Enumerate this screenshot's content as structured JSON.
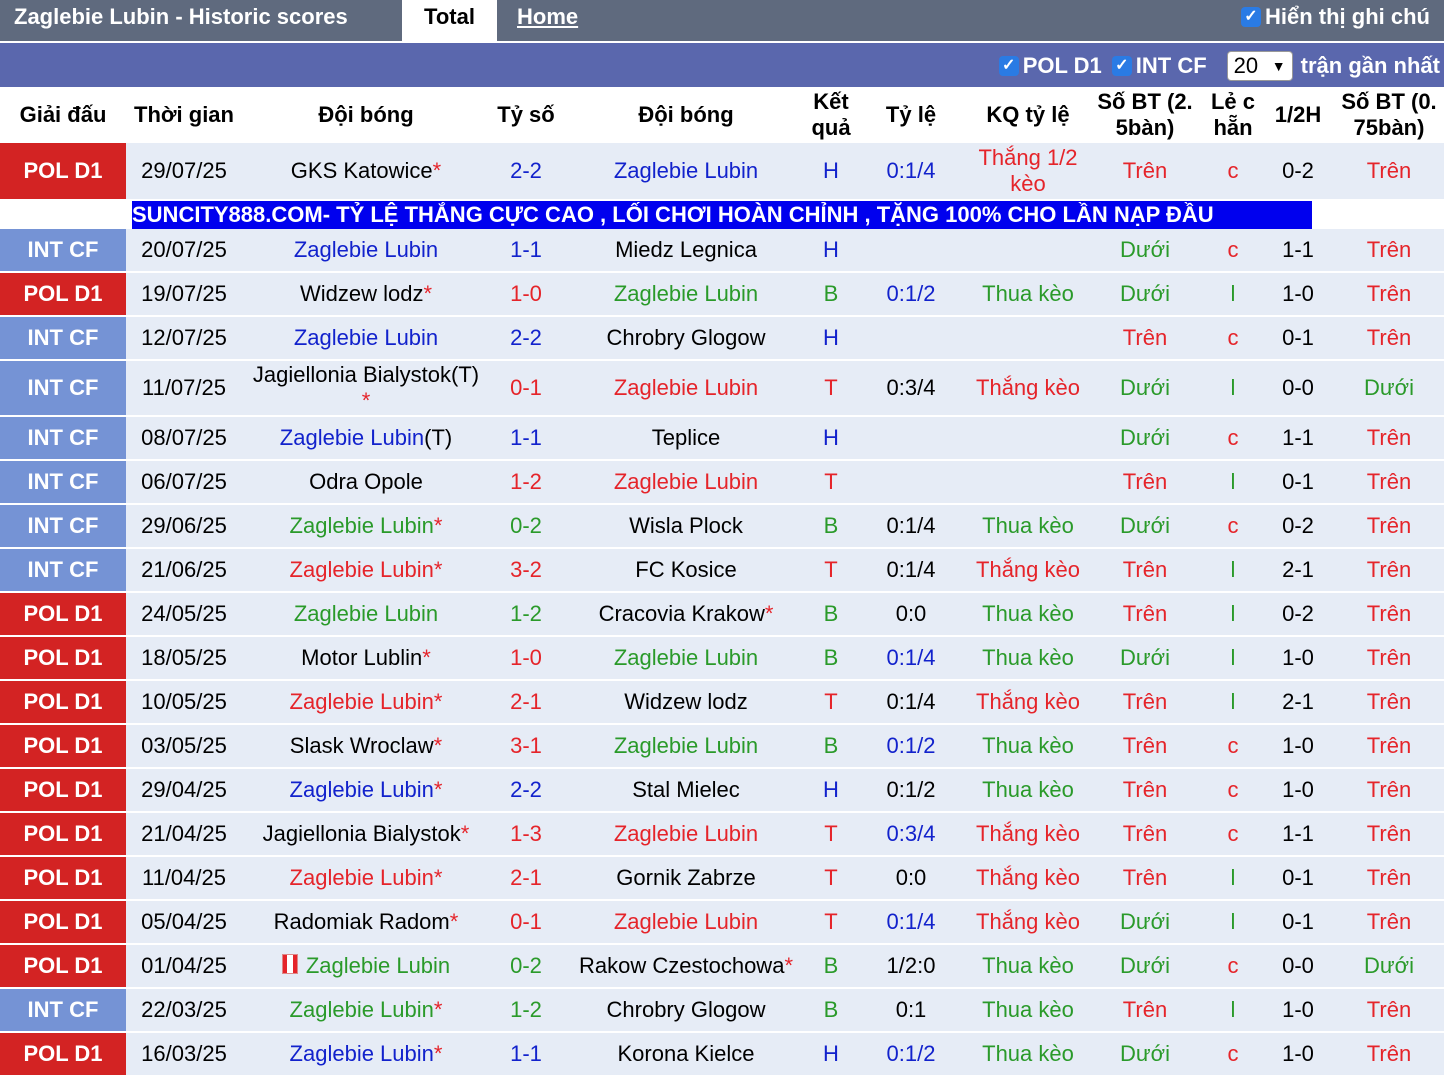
{
  "header": {
    "title": "Zaglebie Lubin - Historic scores",
    "tab_total": "Total",
    "tab_home": "Home",
    "show_notes": "Hiển thị ghi chú"
  },
  "filters": {
    "league1": "POL D1",
    "league2": "INT CF",
    "count": "20",
    "recent_label": "trận gần nhất"
  },
  "columns": [
    "Giải đấu",
    "Thời gian",
    "Đội bóng",
    "Tỷ số",
    "Đội bóng",
    "Kết quả",
    "Tỷ lệ",
    "KQ tỷ lệ",
    "Số BT (2. 5bàn)",
    "Lẻ c hẵn",
    "1/2H",
    "Số BT (0. 75bàn)"
  ],
  "ad_banner": "SUNCITY888.COM- TỶ LỆ THẮNG CỰC CAO , LỐI CHƠI HOÀN CHỈNH , TẶNG 100% CHO LẦN NẠP ĐẦU",
  "colors": {
    "blue": "#1222cc",
    "red": "#e5242a",
    "green": "#2a9a2a",
    "pol_badge": "#d32323",
    "int_badge": "#7593d5",
    "ad_bg": "#0000ee"
  },
  "matches": [
    {
      "league": "POL D1",
      "date": "29/07/25",
      "home": "GKS Katowice",
      "home_star": true,
      "home_color": "black",
      "score": "2-2",
      "score_color": "blue",
      "away": "Zaglebie Lubin",
      "away_star": false,
      "away_color": "blue",
      "result": "H",
      "result_color": "blue",
      "odds": "0:1/4",
      "odds_color": "blue",
      "odds_result": "Thắng 1/2 kèo",
      "odds_result_color": "red",
      "ou25": "Trên",
      "ou25_color": "red",
      "oe": "c",
      "oe_color": "red",
      "half": "0-2",
      "ou075": "Trên",
      "ou075_color": "red"
    },
    {
      "league": "INT CF",
      "date": "20/07/25",
      "home": "Zaglebie Lubin",
      "home_star": false,
      "home_color": "blue",
      "score": "1-1",
      "score_color": "blue",
      "away": "Miedz Legnica",
      "away_star": false,
      "away_color": "black",
      "result": "H",
      "result_color": "blue",
      "odds": "",
      "odds_color": "black",
      "odds_result": "",
      "odds_result_color": "black",
      "ou25": "Dưới",
      "ou25_color": "green",
      "oe": "c",
      "oe_color": "red",
      "half": "1-1",
      "ou075": "Trên",
      "ou075_color": "red"
    },
    {
      "league": "POL D1",
      "date": "19/07/25",
      "home": "Widzew lodz",
      "home_star": true,
      "home_color": "black",
      "score": "1-0",
      "score_color": "red",
      "away": "Zaglebie Lubin",
      "away_star": false,
      "away_color": "green",
      "result": "B",
      "result_color": "green",
      "odds": "0:1/2",
      "odds_color": "blue",
      "odds_result": "Thua kèo",
      "odds_result_color": "green",
      "ou25": "Dưới",
      "ou25_color": "green",
      "oe": "l",
      "oe_color": "green",
      "half": "1-0",
      "ou075": "Trên",
      "ou075_color": "red"
    },
    {
      "league": "INT CF",
      "date": "12/07/25",
      "home": "Zaglebie Lubin",
      "home_star": false,
      "home_color": "blue",
      "score": "2-2",
      "score_color": "blue",
      "away": "Chrobry Glogow",
      "away_star": false,
      "away_color": "black",
      "result": "H",
      "result_color": "blue",
      "odds": "",
      "odds_color": "black",
      "odds_result": "",
      "odds_result_color": "black",
      "ou25": "Trên",
      "ou25_color": "red",
      "oe": "c",
      "oe_color": "red",
      "half": "0-1",
      "ou075": "Trên",
      "ou075_color": "red"
    },
    {
      "league": "INT CF",
      "date": "11/07/25",
      "home": "Jagiellonia Bialystok(T)",
      "home_star": true,
      "home_color": "black",
      "score": "0-1",
      "score_color": "red",
      "away": "Zaglebie Lubin",
      "away_star": false,
      "away_color": "red",
      "result": "T",
      "result_color": "red",
      "odds": "0:3/4",
      "odds_color": "black",
      "odds_result": "Thắng kèo",
      "odds_result_color": "red",
      "ou25": "Dưới",
      "ou25_color": "green",
      "oe": "l",
      "oe_color": "green",
      "half": "0-0",
      "ou075": "Dưới",
      "ou075_color": "green"
    },
    {
      "league": "INT CF",
      "date": "08/07/25",
      "home": "Zaglebie Lubin",
      "home_suffix": "(T)",
      "home_star": false,
      "home_color": "blue",
      "score": "1-1",
      "score_color": "blue",
      "away": "Teplice",
      "away_star": false,
      "away_color": "black",
      "result": "H",
      "result_color": "blue",
      "odds": "",
      "odds_color": "black",
      "odds_result": "",
      "odds_result_color": "black",
      "ou25": "Dưới",
      "ou25_color": "green",
      "oe": "c",
      "oe_color": "red",
      "half": "1-1",
      "ou075": "Trên",
      "ou075_color": "red"
    },
    {
      "league": "INT CF",
      "date": "06/07/25",
      "home": "Odra Opole",
      "home_star": false,
      "home_color": "black",
      "score": "1-2",
      "score_color": "red",
      "away": "Zaglebie Lubin",
      "away_star": false,
      "away_color": "red",
      "result": "T",
      "result_color": "red",
      "odds": "",
      "odds_color": "black",
      "odds_result": "",
      "odds_result_color": "black",
      "ou25": "Trên",
      "ou25_color": "red",
      "oe": "l",
      "oe_color": "green",
      "half": "0-1",
      "ou075": "Trên",
      "ou075_color": "red"
    },
    {
      "league": "INT CF",
      "date": "29/06/25",
      "home": "Zaglebie Lubin",
      "home_star": true,
      "home_color": "green",
      "score": "0-2",
      "score_color": "green",
      "away": "Wisla Plock",
      "away_star": false,
      "away_color": "black",
      "result": "B",
      "result_color": "green",
      "odds": "0:1/4",
      "odds_color": "black",
      "odds_result": "Thua kèo",
      "odds_result_color": "green",
      "ou25": "Dưới",
      "ou25_color": "green",
      "oe": "c",
      "oe_color": "red",
      "half": "0-2",
      "ou075": "Trên",
      "ou075_color": "red"
    },
    {
      "league": "INT CF",
      "date": "21/06/25",
      "home": "Zaglebie Lubin",
      "home_star": true,
      "home_color": "red",
      "score": "3-2",
      "score_color": "red",
      "away": "FC Kosice",
      "away_star": false,
      "away_color": "black",
      "result": "T",
      "result_color": "red",
      "odds": "0:1/4",
      "odds_color": "black",
      "odds_result": "Thắng kèo",
      "odds_result_color": "red",
      "ou25": "Trên",
      "ou25_color": "red",
      "oe": "l",
      "oe_color": "green",
      "half": "2-1",
      "ou075": "Trên",
      "ou075_color": "red"
    },
    {
      "league": "POL D1",
      "date": "24/05/25",
      "home": "Zaglebie Lubin",
      "home_star": false,
      "home_color": "green",
      "score": "1-2",
      "score_color": "green",
      "away": "Cracovia Krakow",
      "away_star": true,
      "away_color": "black",
      "result": "B",
      "result_color": "green",
      "odds": "0:0",
      "odds_color": "black",
      "odds_result": "Thua kèo",
      "odds_result_color": "green",
      "ou25": "Trên",
      "ou25_color": "red",
      "oe": "l",
      "oe_color": "green",
      "half": "0-2",
      "ou075": "Trên",
      "ou075_color": "red"
    },
    {
      "league": "POL D1",
      "date": "18/05/25",
      "home": "Motor Lublin",
      "home_star": true,
      "home_color": "black",
      "score": "1-0",
      "score_color": "red",
      "away": "Zaglebie Lubin",
      "away_star": false,
      "away_color": "green",
      "result": "B",
      "result_color": "green",
      "odds": "0:1/4",
      "odds_color": "blue",
      "odds_result": "Thua kèo",
      "odds_result_color": "green",
      "ou25": "Dưới",
      "ou25_color": "green",
      "oe": "l",
      "oe_color": "green",
      "half": "1-0",
      "ou075": "Trên",
      "ou075_color": "red"
    },
    {
      "league": "POL D1",
      "date": "10/05/25",
      "home": "Zaglebie Lubin",
      "home_star": true,
      "home_color": "red",
      "score": "2-1",
      "score_color": "red",
      "away": "Widzew lodz",
      "away_star": false,
      "away_color": "black",
      "result": "T",
      "result_color": "red",
      "odds": "0:1/4",
      "odds_color": "black",
      "odds_result": "Thắng kèo",
      "odds_result_color": "red",
      "ou25": "Trên",
      "ou25_color": "red",
      "oe": "l",
      "oe_color": "green",
      "half": "2-1",
      "ou075": "Trên",
      "ou075_color": "red"
    },
    {
      "league": "POL D1",
      "date": "03/05/25",
      "home": "Slask Wroclaw",
      "home_star": true,
      "home_color": "black",
      "score": "3-1",
      "score_color": "red",
      "away": "Zaglebie Lubin",
      "away_star": false,
      "away_color": "green",
      "result": "B",
      "result_color": "green",
      "odds": "0:1/2",
      "odds_color": "blue",
      "odds_result": "Thua kèo",
      "odds_result_color": "green",
      "ou25": "Trên",
      "ou25_color": "red",
      "oe": "c",
      "oe_color": "red",
      "half": "1-0",
      "ou075": "Trên",
      "ou075_color": "red"
    },
    {
      "league": "POL D1",
      "date": "29/04/25",
      "home": "Zaglebie Lubin",
      "home_star": true,
      "home_color": "blue",
      "score": "2-2",
      "score_color": "blue",
      "away": "Stal Mielec",
      "away_star": false,
      "away_color": "black",
      "result": "H",
      "result_color": "blue",
      "odds": "0:1/2",
      "odds_color": "black",
      "odds_result": "Thua kèo",
      "odds_result_color": "green",
      "ou25": "Trên",
      "ou25_color": "red",
      "oe": "c",
      "oe_color": "red",
      "half": "1-0",
      "ou075": "Trên",
      "ou075_color": "red"
    },
    {
      "league": "POL D1",
      "date": "21/04/25",
      "home": "Jagiellonia Bialystok",
      "home_star": true,
      "home_color": "black",
      "score": "1-3",
      "score_color": "red",
      "away": "Zaglebie Lubin",
      "away_star": false,
      "away_color": "red",
      "result": "T",
      "result_color": "red",
      "odds": "0:3/4",
      "odds_color": "blue",
      "odds_result": "Thắng kèo",
      "odds_result_color": "red",
      "ou25": "Trên",
      "ou25_color": "red",
      "oe": "c",
      "oe_color": "red",
      "half": "1-1",
      "ou075": "Trên",
      "ou075_color": "red"
    },
    {
      "league": "POL D1",
      "date": "11/04/25",
      "home": "Zaglebie Lubin",
      "home_star": true,
      "home_color": "red",
      "score": "2-1",
      "score_color": "red",
      "away": "Gornik Zabrze",
      "away_star": false,
      "away_color": "black",
      "result": "T",
      "result_color": "red",
      "odds": "0:0",
      "odds_color": "black",
      "odds_result": "Thắng kèo",
      "odds_result_color": "red",
      "ou25": "Trên",
      "ou25_color": "red",
      "oe": "l",
      "oe_color": "green",
      "half": "0-1",
      "ou075": "Trên",
      "ou075_color": "red"
    },
    {
      "league": "POL D1",
      "date": "05/04/25",
      "home": "Radomiak Radom",
      "home_star": true,
      "home_color": "black",
      "score": "0-1",
      "score_color": "red",
      "away": "Zaglebie Lubin",
      "away_star": false,
      "away_color": "red",
      "result": "T",
      "result_color": "red",
      "odds": "0:1/4",
      "odds_color": "blue",
      "odds_result": "Thắng kèo",
      "odds_result_color": "red",
      "ou25": "Dưới",
      "ou25_color": "green",
      "oe": "l",
      "oe_color": "green",
      "half": "0-1",
      "ou075": "Trên",
      "ou075_color": "red"
    },
    {
      "league": "POL D1",
      "date": "01/04/25",
      "home": "Zaglebie Lubin",
      "home_flag": true,
      "home_star": false,
      "home_color": "green",
      "score": "0-2",
      "score_color": "green",
      "away": "Rakow Czestochowa",
      "away_star": true,
      "away_color": "black",
      "result": "B",
      "result_color": "green",
      "odds": "1/2:0",
      "odds_color": "black",
      "odds_result": "Thua kèo",
      "odds_result_color": "green",
      "ou25": "Dưới",
      "ou25_color": "green",
      "oe": "c",
      "oe_color": "red",
      "half": "0-0",
      "ou075": "Dưới",
      "ou075_color": "green"
    },
    {
      "league": "INT CF",
      "date": "22/03/25",
      "home": "Zaglebie Lubin",
      "home_star": true,
      "home_color": "green",
      "score": "1-2",
      "score_color": "green",
      "away": "Chrobry Glogow",
      "away_star": false,
      "away_color": "black",
      "result": "B",
      "result_color": "green",
      "odds": "0:1",
      "odds_color": "black",
      "odds_result": "Thua kèo",
      "odds_result_color": "green",
      "ou25": "Trên",
      "ou25_color": "red",
      "oe": "l",
      "oe_color": "green",
      "half": "1-0",
      "ou075": "Trên",
      "ou075_color": "red"
    },
    {
      "league": "POL D1",
      "date": "16/03/25",
      "home": "Zaglebie Lubin",
      "home_star": true,
      "home_color": "blue",
      "score": "1-1",
      "score_color": "blue",
      "away": "Korona Kielce",
      "away_star": false,
      "away_color": "black",
      "result": "H",
      "result_color": "blue",
      "odds": "0:1/2",
      "odds_color": "blue",
      "odds_result": "Thua kèo",
      "odds_result_color": "green",
      "ou25": "Dưới",
      "ou25_color": "green",
      "oe": "c",
      "oe_color": "red",
      "half": "1-0",
      "ou075": "Trên",
      "ou075_color": "red"
    }
  ]
}
